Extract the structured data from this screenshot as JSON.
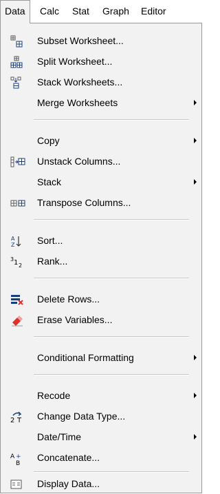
{
  "menubar": {
    "items": [
      "Data",
      "Calc",
      "Stat",
      "Graph",
      "Editor"
    ]
  },
  "menu": {
    "items": [
      {
        "label": "Subset Worksheet...",
        "icon": "subset-worksheet-icon",
        "submenu": false
      },
      {
        "label": "Split Worksheet...",
        "icon": "split-worksheet-icon",
        "submenu": false
      },
      {
        "label": "Stack Worksheets...",
        "icon": "stack-worksheets-icon",
        "submenu": false
      },
      {
        "label": "Merge Worksheets",
        "icon": "",
        "submenu": true
      },
      {
        "label": "Copy",
        "icon": "",
        "submenu": true
      },
      {
        "label": "Unstack Columns...",
        "icon": "unstack-columns-icon",
        "submenu": false
      },
      {
        "label": "Stack",
        "icon": "",
        "submenu": true
      },
      {
        "label": "Transpose Columns...",
        "icon": "transpose-columns-icon",
        "submenu": false
      },
      {
        "label": "Sort...",
        "icon": "sort-icon",
        "submenu": false
      },
      {
        "label": "Rank...",
        "icon": "rank-icon",
        "submenu": false
      },
      {
        "label": "Delete Rows...",
        "icon": "delete-rows-icon",
        "submenu": false
      },
      {
        "label": "Erase Variables...",
        "icon": "eraser-icon",
        "submenu": false
      },
      {
        "label": "Conditional Formatting",
        "icon": "",
        "submenu": true
      },
      {
        "label": "Recode",
        "icon": "",
        "submenu": true
      },
      {
        "label": "Change Data Type...",
        "icon": "change-data-type-icon",
        "submenu": false
      },
      {
        "label": "Date/Time",
        "icon": "",
        "submenu": true
      },
      {
        "label": "Concatenate...",
        "icon": "concatenate-icon",
        "submenu": false
      },
      {
        "label": "Display Data...",
        "icon": "display-data-icon",
        "submenu": false
      }
    ]
  },
  "colors": {
    "menu_background": "#f2f2f2",
    "separator": "#c8c8c8",
    "icon_blue": "#1a3e7a",
    "icon_red": "#e0302a"
  }
}
